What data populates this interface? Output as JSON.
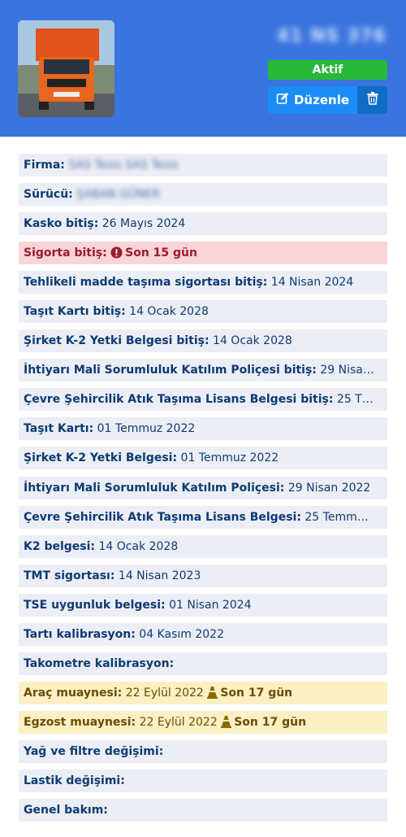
{
  "header": {
    "plate": "41 NS 376",
    "status": "Aktif",
    "edit_label": "Düzenle"
  },
  "rows": [
    {
      "label": "Firma:",
      "value": "SAS Tesis SAS Tesis"
    },
    {
      "label": "Sürücü:",
      "value": "ŞABAN GÜNER"
    },
    {
      "label": "Kasko bitiş:",
      "value": "26 Mayıs 2024"
    },
    {
      "label": "Sigorta bitiş:",
      "value": "Son 15 gün"
    },
    {
      "label": "Tehlikeli madde taşıma sigortası bitiş:",
      "value": "14 Nisan 2024"
    },
    {
      "label": "Taşıt Kartı bitiş:",
      "value": "14 Ocak 2028"
    },
    {
      "label": "Şirket K-2 Yetki Belgesi bitiş:",
      "value": "14 Ocak 2028"
    },
    {
      "label": "İhtiyarı Mali Sorumluluk Katılım Poliçesi bitiş:",
      "value": "29 Nisa…"
    },
    {
      "label": "Çevre Şehircilik Atık Taşıma Lisans Belgesi bitiş:",
      "value": "25 T…"
    },
    {
      "label": "Taşıt Kartı:",
      "value": "01 Temmuz 2022"
    },
    {
      "label": "Şirket K-2 Yetki Belgesi:",
      "value": "01 Temmuz 2022"
    },
    {
      "label": "İhtiyarı Mali Sorumluluk Katılım Poliçesi:",
      "value": "29 Nisan 2022"
    },
    {
      "label": "Çevre Şehircilik Atık Taşıma Lisans Belgesi:",
      "value": "25 Temm…"
    },
    {
      "label": "K2 belgesi:",
      "value": "14 Ocak 2028"
    },
    {
      "label": "TMT sigortası:",
      "value": "14 Nisan 2023"
    },
    {
      "label": "TSE uygunluk belgesi:",
      "value": "01 Nisan 2024"
    },
    {
      "label": "Tartı kalibrasyon:",
      "value": "04 Kasım 2022"
    },
    {
      "label": "Takometre kalibrasyon:",
      "value": ""
    },
    {
      "label": "Araç muaynesi:",
      "value": "22 Eylül 2022",
      "badge": "Son 17 gün"
    },
    {
      "label": "Egzost muaynesi:",
      "value": "22 Eylül 2022",
      "badge": "Son 17 gün"
    },
    {
      "label": "Yağ ve filtre değişimi:",
      "value": ""
    },
    {
      "label": "Lastik değişimi:",
      "value": ""
    },
    {
      "label": "Genel bakım:",
      "value": ""
    }
  ]
}
